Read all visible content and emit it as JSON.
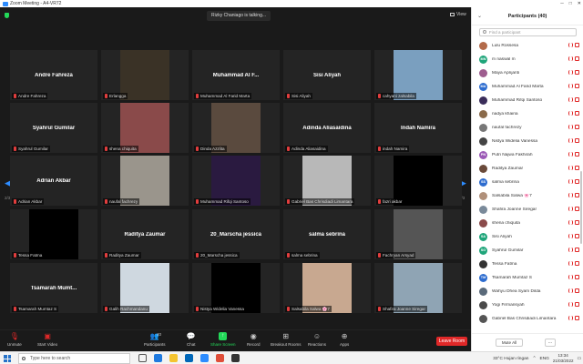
{
  "window": {
    "title": "Zoom Meeting - A4-VR72"
  },
  "meeting": {
    "talking": "Rizky Chaniago is talking...",
    "view_label": "View"
  },
  "pagination": {
    "left": "2/3",
    "right": "2/3"
  },
  "tiles": [
    {
      "name": "Andre Fahreza",
      "label": "Andre Fahreza",
      "photo": null
    },
    {
      "name": "",
      "label": "Erlangga",
      "photo": "#3a3226"
    },
    {
      "name": "Muhammad Al F...",
      "label": "Muhammad Al Farid Marta",
      "photo": null
    },
    {
      "name": "Sisi Aliyah",
      "label": "Sisi Aliyah",
      "photo": null
    },
    {
      "name": "",
      "label": "cahyani zalsabila",
      "photo": "#7a9fbf"
    },
    {
      "name": "Syahrul Gumilar",
      "label": "Syahrul Gumilar",
      "photo": null
    },
    {
      "name": "",
      "label": "shena chiquita",
      "photo": "#8a4a4a"
    },
    {
      "name": "",
      "label": "Dinda Azzlita",
      "photo": "#5a4a3e"
    },
    {
      "name": "Adinda Aliasaidina",
      "label": "Adinda Aliasaidina",
      "photo": null
    },
    {
      "name": "Indah Namira",
      "label": "indah Namira",
      "photo": null
    },
    {
      "name": "Adrian Akbar",
      "label": "Adrian Akbar",
      "photo": null
    },
    {
      "name": "",
      "label": "naufal fachrezy",
      "photo": "#9a958c"
    },
    {
      "name": "",
      "label": "Muhammad Rifqi Santoso",
      "photo": "#2a1a40"
    },
    {
      "name": "",
      "label": "Gabriel Bas Chrisdiadi Limantara",
      "photo": "#b8b8b8"
    },
    {
      "name": "",
      "label": "fazri akbar",
      "photo": "#000000"
    },
    {
      "name": "",
      "label": "Tessa Fatma",
      "photo": "#000000"
    },
    {
      "name": "Raditya Zaumar",
      "label": "Raditya Zaumar",
      "photo": null
    },
    {
      "name": "20_Marscha jessica",
      "label": "20_Marscha jessica",
      "photo": null
    },
    {
      "name": "salma sebrina",
      "label": "salma sebrina",
      "photo": null
    },
    {
      "name": "",
      "label": "Fachryan Arsyad",
      "photo": "#555555"
    },
    {
      "name": "Tsamarah Mumt...",
      "label": "Tsamarah Mumtaz S",
      "photo": null
    },
    {
      "name": "",
      "label": "Galih Rachmandanu",
      "photo": "#cfd8e0"
    },
    {
      "name": "",
      "label": "Nistya Widelia Vanessa",
      "photo": "#000000"
    },
    {
      "name": "",
      "label": "Salsabila Salwa 🌸7",
      "photo": "#c8a890"
    },
    {
      "name": "",
      "label": "Shafira Joanne Siregar",
      "photo": "#8fa4b4"
    }
  ],
  "toolbar": {
    "unmute": "Unmute",
    "start_video": "Start Video",
    "participants": "Participants",
    "participants_count": "40",
    "chat": "Chat",
    "share_screen": "Share Screen",
    "record": "Record",
    "breakout": "Breakout Rooms",
    "reactions": "Reactions",
    "apps": "Apps",
    "leave": "Leave Room"
  },
  "panel": {
    "title": "Participants (40)",
    "search_placeholder": "Find a participant",
    "mute_all": "Mute All",
    "more": "..."
  },
  "participants": [
    {
      "name": "Lulu Rossesa",
      "initials": "",
      "color": "#b36b4a"
    },
    {
      "name": "m naswal m",
      "initials": "MN",
      "color": "#1fa57a"
    },
    {
      "name": "Maya Aprijanti",
      "initials": "",
      "color": "#9e5d8f"
    },
    {
      "name": "Muhammad Al Farid Marta",
      "initials": "MA",
      "color": "#2d6ccf"
    },
    {
      "name": "Muhammad Rifqi Santoso",
      "initials": "",
      "color": "#3a2d5a"
    },
    {
      "name": "nadya khairia",
      "initials": "",
      "color": "#8a6a4a"
    },
    {
      "name": "naufal fachrezy",
      "initials": "",
      "color": "#777777"
    },
    {
      "name": "Nistya Widelia Vanessa",
      "initials": "",
      "color": "#444444"
    },
    {
      "name": "Putri Najwa Fakhirah",
      "initials": "PN",
      "color": "#9b59b6"
    },
    {
      "name": "Raditya Zaumar",
      "initials": "",
      "color": "#6a4a3a"
    },
    {
      "name": "salma sebrina",
      "initials": "SS",
      "color": "#2d6ccf"
    },
    {
      "name": "Salsabila Salwa 🌸7",
      "initials": "",
      "color": "#b0907a"
    },
    {
      "name": "Shafira Joanne Siregar",
      "initials": "",
      "color": "#7a8a9a"
    },
    {
      "name": "shena chiquita",
      "initials": "",
      "color": "#8a4a4a"
    },
    {
      "name": "Sisi Aliyah",
      "initials": "SA",
      "color": "#1fa57a"
    },
    {
      "name": "Syahrul Gumilar",
      "initials": "SG",
      "color": "#1fa57a"
    },
    {
      "name": "Tessa Fatma",
      "initials": "",
      "color": "#333333"
    },
    {
      "name": "Tsamarah Mumtaz S",
      "initials": "TM",
      "color": "#2d6ccf"
    },
    {
      "name": "Wahyu Dhea Syam Dilda",
      "initials": "",
      "color": "#5a6a7a"
    },
    {
      "name": "Yogi Firmansyah",
      "initials": "",
      "color": "#4a4a4a"
    },
    {
      "name": "Gabriel Bas Chrisdiadi Limantara",
      "initials": "",
      "color": "#555555"
    }
  ],
  "taskbar": {
    "search_placeholder": "Type here to search",
    "weather": "33°C  Hujan ringan",
    "lang": "ENG",
    "time": "13:34",
    "date": "21/03/2022"
  }
}
